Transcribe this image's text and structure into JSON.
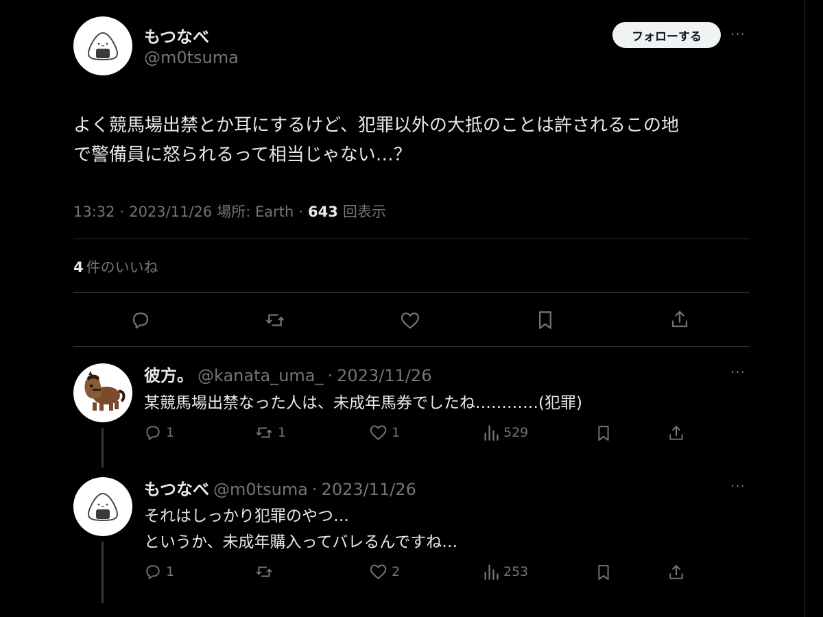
{
  "main_tweet": {
    "display_name": "もつなべ",
    "handle": "@m0tsuma",
    "follow_label": "フォローする",
    "more_label": "···",
    "text_line1": "よく競馬場出禁とか耳にするけど、犯罪以外の大抵のことは許されるこの地",
    "text_line2": "で警備員に怒られるって相当じゃない…？",
    "time": "13:32",
    "date": "2023/11/26",
    "location": "場所: Earth",
    "views_count": "643",
    "views_label": "回表示",
    "sep": "·",
    "likes_count": "4",
    "likes_label": "件のいいね"
  },
  "replies": [
    {
      "display_name": "彼方。",
      "handle": "@kanata_uma_",
      "sep": "·",
      "date": "2023/11/26",
      "more_label": "···",
      "text_lines": [
        "某競馬場出禁なった人は、未成年馬券でしたね…………(犯罪)"
      ],
      "reply_count": "1",
      "retweet_count": "1",
      "like_count": "1",
      "view_count": "529"
    },
    {
      "display_name": "もつなべ",
      "handle": "@m0tsuma",
      "sep": "·",
      "date": "2023/11/26",
      "more_label": "···",
      "text_lines": [
        "それはしっかり犯罪のやつ…",
        "というか、未成年購入ってバレるんですね…"
      ],
      "reply_count": "1",
      "retweet_count": "",
      "like_count": "2",
      "view_count": "253"
    }
  ],
  "colors": {
    "background": "#000000",
    "text": "#e7e9ea",
    "muted": "#71767b",
    "divider": "#2f3336"
  }
}
